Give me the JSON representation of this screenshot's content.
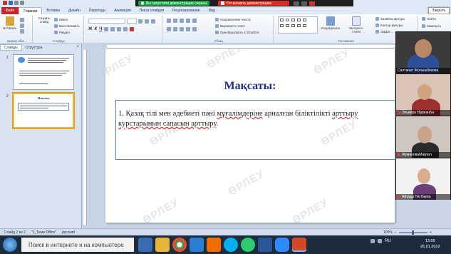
{
  "share_banner": {
    "started_text": "Вы запустили демонстрацию экрана",
    "stop_text": "Остановить демонстрацию"
  },
  "ribbon": {
    "tabs": [
      "Файл",
      "Главная",
      "Вставка",
      "Дизайн",
      "Переходы",
      "Анимация",
      "Показ слайдов",
      "Рецензирование",
      "Вид"
    ],
    "active_tab": "Главная",
    "paste": "Вставить",
    "new_slide": "Создать слайд",
    "layout": "Макет",
    "reset": "Восстановить",
    "section": "Раздел",
    "groups": {
      "clipboard": "Буфер обм...",
      "slides": "Слайды",
      "paragraph": "Абзац",
      "drawing": "Рисование"
    },
    "text_direction": "Направление текста",
    "align_text": "Выровнять текст",
    "smartart": "Преобразовать в SmartArt",
    "arrange": "Упорядочить",
    "quick_styles": "Экспресс-стили",
    "shape_fill": "Заливка фигуры",
    "shape_outline": "Контур фигуры",
    "effects": "Эффе...",
    "find": "Найти",
    "replace": "Заменить"
  },
  "close_tooltip": "Закрыть",
  "left_panel": {
    "tabs": [
      "Слайды",
      "Структура"
    ],
    "close_glyph": "×",
    "slide_numbers": [
      "1",
      "2"
    ],
    "thumb2_title": "Мақсаты"
  },
  "slide": {
    "title": "Мақсаты:",
    "text_before": "1. Қазақ тілі мен әдебиеті пәні ",
    "text_err1": "мұғалімдеріне",
    "text_mid": " арналған біліктілікті ",
    "text_err2": "арттыру",
    "text_break": " ",
    "text_err3": "курстарынын сапасын арттыру",
    "text_end": ".",
    "watermark": "ӨРЛЕУ"
  },
  "participants": [
    {
      "name": "Салтанат Жолышбекова"
    },
    {
      "name": "Эльвира НуржанБа"
    },
    {
      "name": "ЖумановаМақпал"
    },
    {
      "name": "Айзада Натбаева"
    }
  ],
  "statusbar": {
    "slide_info": "Слайд 2 из 2",
    "theme": "\"1_Тема Office\"",
    "language": "русский",
    "zoom": "100%"
  },
  "taskbar": {
    "search_placeholder": "Поиск в интернете и на компьютере",
    "lang": "RU",
    "time": "13:09",
    "date": "26.01.2022"
  },
  "colors": {
    "title_blue": "#1b2f8a",
    "file_tab": "#c8272e",
    "share_green": "#1fa34a",
    "share_red": "#d93025"
  }
}
